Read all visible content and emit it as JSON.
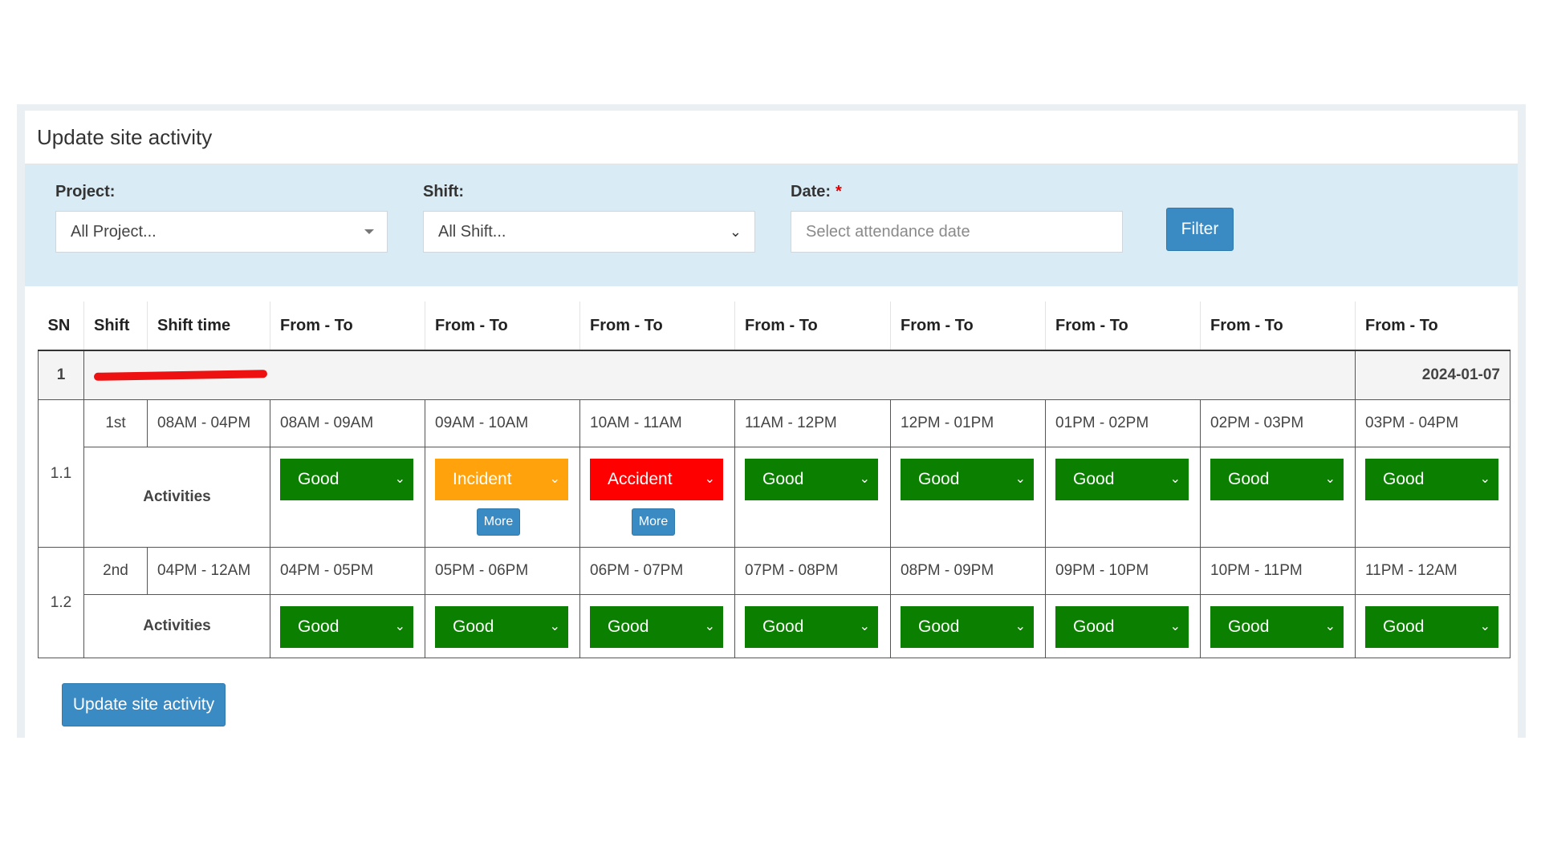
{
  "page": {
    "title": "Update site activity"
  },
  "filters": {
    "project_label": "Project:",
    "project_value": "All Project...",
    "shift_label": "Shift:",
    "shift_value": "All Shift...",
    "date_label": "Date:",
    "date_required_mark": "*",
    "date_placeholder": "Select attendance date",
    "filter_button": "Filter"
  },
  "table": {
    "headers": [
      "SN",
      "Shift",
      "Shift time",
      "From - To",
      "From - To",
      "From - To",
      "From - To",
      "From - To",
      "From - To",
      "From - To",
      "From - To"
    ],
    "project": {
      "sn": "1",
      "date": "2024-01-07"
    },
    "activities_label": "Activities",
    "more_label": "More",
    "shifts": [
      {
        "sn": "1.1",
        "shift": "1st",
        "shift_time": "08AM - 04PM",
        "slots": [
          "08AM - 09AM",
          "09AM - 10AM",
          "10AM - 11AM",
          "11AM - 12PM",
          "12PM - 01PM",
          "01PM - 02PM",
          "02PM - 03PM",
          "03PM - 04PM"
        ],
        "statuses": [
          "Good",
          "Incident",
          "Accident",
          "Good",
          "Good",
          "Good",
          "Good",
          "Good"
        ]
      },
      {
        "sn": "1.2",
        "shift": "2nd",
        "shift_time": "04PM - 12AM",
        "slots": [
          "04PM - 05PM",
          "05PM - 06PM",
          "06PM - 07PM",
          "07PM - 08PM",
          "08PM - 09PM",
          "09PM - 10PM",
          "10PM - 11PM",
          "11PM - 12AM"
        ],
        "statuses": [
          "Good",
          "Good",
          "Good",
          "Good",
          "Good",
          "Good",
          "Good",
          "Good"
        ]
      }
    ]
  },
  "actions": {
    "update_button": "Update site activity"
  },
  "colors": {
    "good": "#0b8000",
    "incident": "#ffa20c",
    "accident": "#ff0000",
    "primary": "#3a8ac4",
    "filter_panel": "#d9ebf5"
  },
  "icons": {
    "select_caret": "caret-down-icon",
    "select_chevron": "chevron-down-icon"
  }
}
